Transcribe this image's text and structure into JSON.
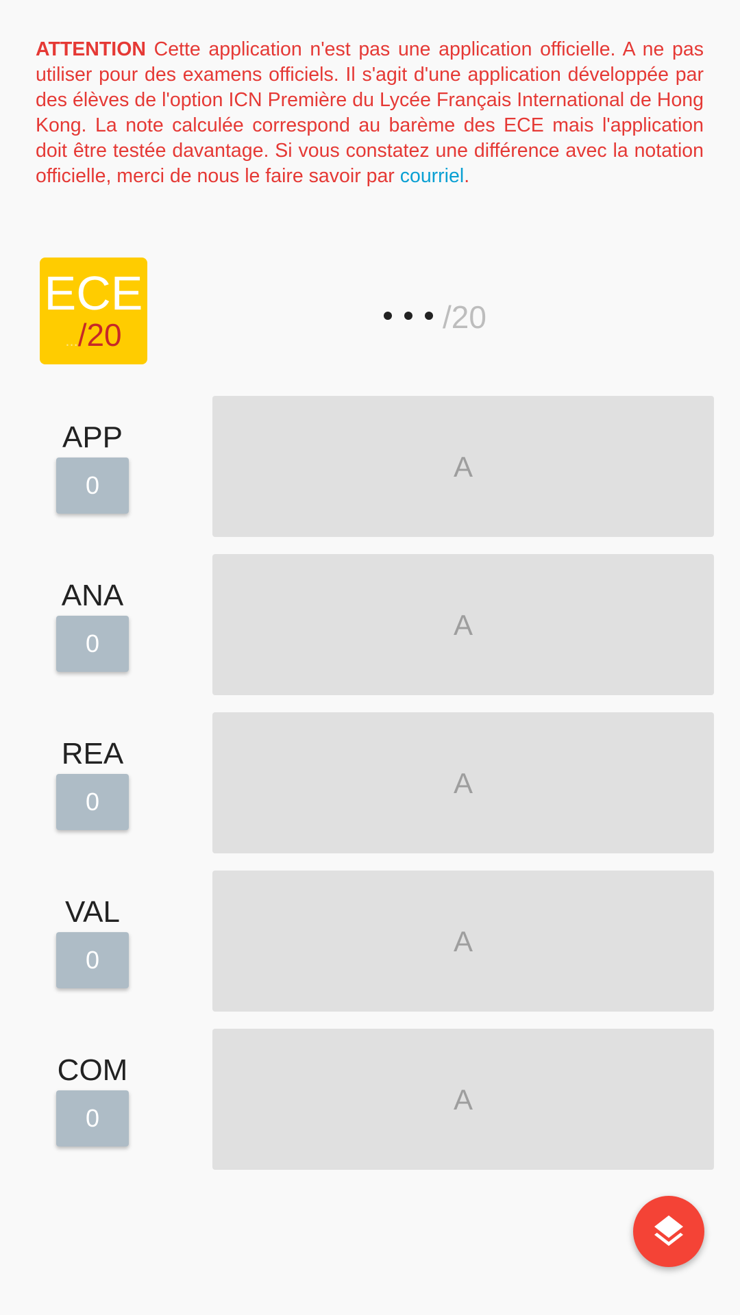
{
  "warning": {
    "title": "ATTENTION",
    "body": "Cette application n'est pas une application officielle. A ne pas utiliser pour des examens officiels. Il s'agit d'une application développée par des élèves de l'option ICN Première du Lycée Français International de Hong Kong. La note calculée correspond au barème des ECE mais l'application doit être testée davantage. Si vous constatez une différence avec la notation officielle, merci de nous le faire savoir par",
    "link_text": "courriel",
    "end": "."
  },
  "badge": {
    "title": "ECE",
    "dots": "...",
    "max": "/20"
  },
  "total": {
    "max": "/20"
  },
  "criteria": [
    {
      "label": "APP",
      "score": "0",
      "grade": "A"
    },
    {
      "label": "ANA",
      "score": "0",
      "grade": "A"
    },
    {
      "label": "REA",
      "score": "0",
      "grade": "A"
    },
    {
      "label": "VAL",
      "score": "0",
      "grade": "A"
    },
    {
      "label": "COM",
      "score": "0",
      "grade": "A"
    }
  ],
  "fab": {
    "icon": "layers-icon"
  },
  "colors": {
    "warning": "#e53935",
    "link": "#0aa0d3",
    "badge": "#ffcc00",
    "fab": "#f44336",
    "score_button": "#aebcc6",
    "panel": "#e0e0e0"
  }
}
